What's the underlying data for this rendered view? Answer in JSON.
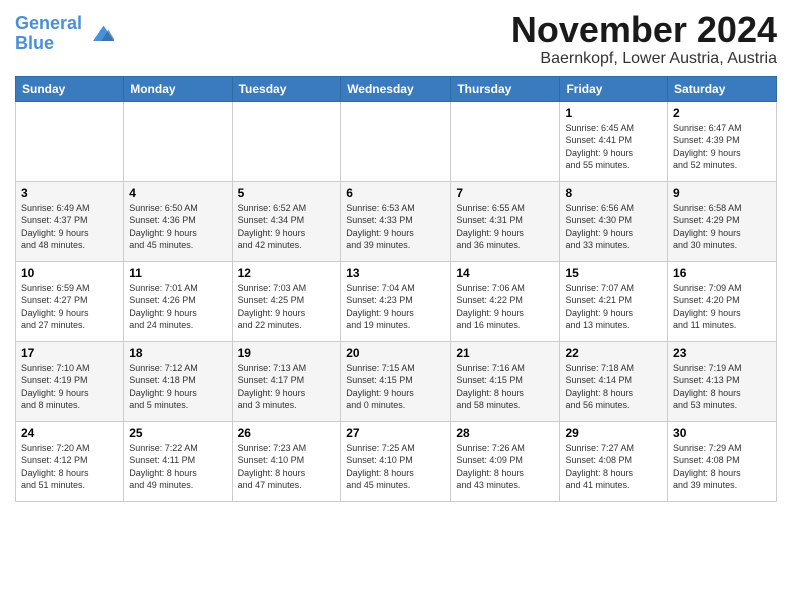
{
  "logo": {
    "line1": "General",
    "line2": "Blue"
  },
  "title": "November 2024",
  "location": "Baernkopf, Lower Austria, Austria",
  "days_of_week": [
    "Sunday",
    "Monday",
    "Tuesday",
    "Wednesday",
    "Thursday",
    "Friday",
    "Saturday"
  ],
  "weeks": [
    [
      {
        "day": "",
        "info": ""
      },
      {
        "day": "",
        "info": ""
      },
      {
        "day": "",
        "info": ""
      },
      {
        "day": "",
        "info": ""
      },
      {
        "day": "",
        "info": ""
      },
      {
        "day": "1",
        "info": "Sunrise: 6:45 AM\nSunset: 4:41 PM\nDaylight: 9 hours\nand 55 minutes."
      },
      {
        "day": "2",
        "info": "Sunrise: 6:47 AM\nSunset: 4:39 PM\nDaylight: 9 hours\nand 52 minutes."
      }
    ],
    [
      {
        "day": "3",
        "info": "Sunrise: 6:49 AM\nSunset: 4:37 PM\nDaylight: 9 hours\nand 48 minutes."
      },
      {
        "day": "4",
        "info": "Sunrise: 6:50 AM\nSunset: 4:36 PM\nDaylight: 9 hours\nand 45 minutes."
      },
      {
        "day": "5",
        "info": "Sunrise: 6:52 AM\nSunset: 4:34 PM\nDaylight: 9 hours\nand 42 minutes."
      },
      {
        "day": "6",
        "info": "Sunrise: 6:53 AM\nSunset: 4:33 PM\nDaylight: 9 hours\nand 39 minutes."
      },
      {
        "day": "7",
        "info": "Sunrise: 6:55 AM\nSunset: 4:31 PM\nDaylight: 9 hours\nand 36 minutes."
      },
      {
        "day": "8",
        "info": "Sunrise: 6:56 AM\nSunset: 4:30 PM\nDaylight: 9 hours\nand 33 minutes."
      },
      {
        "day": "9",
        "info": "Sunrise: 6:58 AM\nSunset: 4:29 PM\nDaylight: 9 hours\nand 30 minutes."
      }
    ],
    [
      {
        "day": "10",
        "info": "Sunrise: 6:59 AM\nSunset: 4:27 PM\nDaylight: 9 hours\nand 27 minutes."
      },
      {
        "day": "11",
        "info": "Sunrise: 7:01 AM\nSunset: 4:26 PM\nDaylight: 9 hours\nand 24 minutes."
      },
      {
        "day": "12",
        "info": "Sunrise: 7:03 AM\nSunset: 4:25 PM\nDaylight: 9 hours\nand 22 minutes."
      },
      {
        "day": "13",
        "info": "Sunrise: 7:04 AM\nSunset: 4:23 PM\nDaylight: 9 hours\nand 19 minutes."
      },
      {
        "day": "14",
        "info": "Sunrise: 7:06 AM\nSunset: 4:22 PM\nDaylight: 9 hours\nand 16 minutes."
      },
      {
        "day": "15",
        "info": "Sunrise: 7:07 AM\nSunset: 4:21 PM\nDaylight: 9 hours\nand 13 minutes."
      },
      {
        "day": "16",
        "info": "Sunrise: 7:09 AM\nSunset: 4:20 PM\nDaylight: 9 hours\nand 11 minutes."
      }
    ],
    [
      {
        "day": "17",
        "info": "Sunrise: 7:10 AM\nSunset: 4:19 PM\nDaylight: 9 hours\nand 8 minutes."
      },
      {
        "day": "18",
        "info": "Sunrise: 7:12 AM\nSunset: 4:18 PM\nDaylight: 9 hours\nand 5 minutes."
      },
      {
        "day": "19",
        "info": "Sunrise: 7:13 AM\nSunset: 4:17 PM\nDaylight: 9 hours\nand 3 minutes."
      },
      {
        "day": "20",
        "info": "Sunrise: 7:15 AM\nSunset: 4:15 PM\nDaylight: 9 hours\nand 0 minutes."
      },
      {
        "day": "21",
        "info": "Sunrise: 7:16 AM\nSunset: 4:15 PM\nDaylight: 8 hours\nand 58 minutes."
      },
      {
        "day": "22",
        "info": "Sunrise: 7:18 AM\nSunset: 4:14 PM\nDaylight: 8 hours\nand 56 minutes."
      },
      {
        "day": "23",
        "info": "Sunrise: 7:19 AM\nSunset: 4:13 PM\nDaylight: 8 hours\nand 53 minutes."
      }
    ],
    [
      {
        "day": "24",
        "info": "Sunrise: 7:20 AM\nSunset: 4:12 PM\nDaylight: 8 hours\nand 51 minutes."
      },
      {
        "day": "25",
        "info": "Sunrise: 7:22 AM\nSunset: 4:11 PM\nDaylight: 8 hours\nand 49 minutes."
      },
      {
        "day": "26",
        "info": "Sunrise: 7:23 AM\nSunset: 4:10 PM\nDaylight: 8 hours\nand 47 minutes."
      },
      {
        "day": "27",
        "info": "Sunrise: 7:25 AM\nSunset: 4:10 PM\nDaylight: 8 hours\nand 45 minutes."
      },
      {
        "day": "28",
        "info": "Sunrise: 7:26 AM\nSunset: 4:09 PM\nDaylight: 8 hours\nand 43 minutes."
      },
      {
        "day": "29",
        "info": "Sunrise: 7:27 AM\nSunset: 4:08 PM\nDaylight: 8 hours\nand 41 minutes."
      },
      {
        "day": "30",
        "info": "Sunrise: 7:29 AM\nSunset: 4:08 PM\nDaylight: 8 hours\nand 39 minutes."
      }
    ]
  ]
}
